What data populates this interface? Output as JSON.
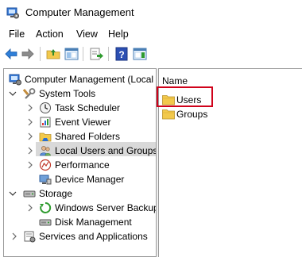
{
  "window": {
    "title": "Computer Management"
  },
  "menu": [
    "File",
    "Action",
    "View",
    "Help"
  ],
  "toolbar": {
    "buttons": [
      "back-icon",
      "forward-icon",
      "up-folder-icon",
      "show-hide-tree-icon",
      "export-list-icon",
      "help-icon",
      "show-hide-action-pane-icon"
    ]
  },
  "tree": {
    "root": "Computer Management (Local",
    "system_tools": "System Tools",
    "task_scheduler": "Task Scheduler",
    "event_viewer": "Event Viewer",
    "shared_folders": "Shared Folders",
    "local_users_groups": "Local Users and Groups",
    "performance": "Performance",
    "device_manager": "Device Manager",
    "storage": "Storage",
    "windows_server_backup": "Windows Server Backup",
    "disk_management": "Disk Management",
    "services_apps": "Services and Applications",
    "selected": "Local Users and Groups"
  },
  "list": {
    "column_name": "Name",
    "items": [
      "Users",
      "Groups"
    ],
    "highlighted": "Users"
  },
  "colors": {
    "highlight_border": "#d0021b",
    "selection_bg": "#d9d9d9",
    "folder": "#f2c94c"
  }
}
